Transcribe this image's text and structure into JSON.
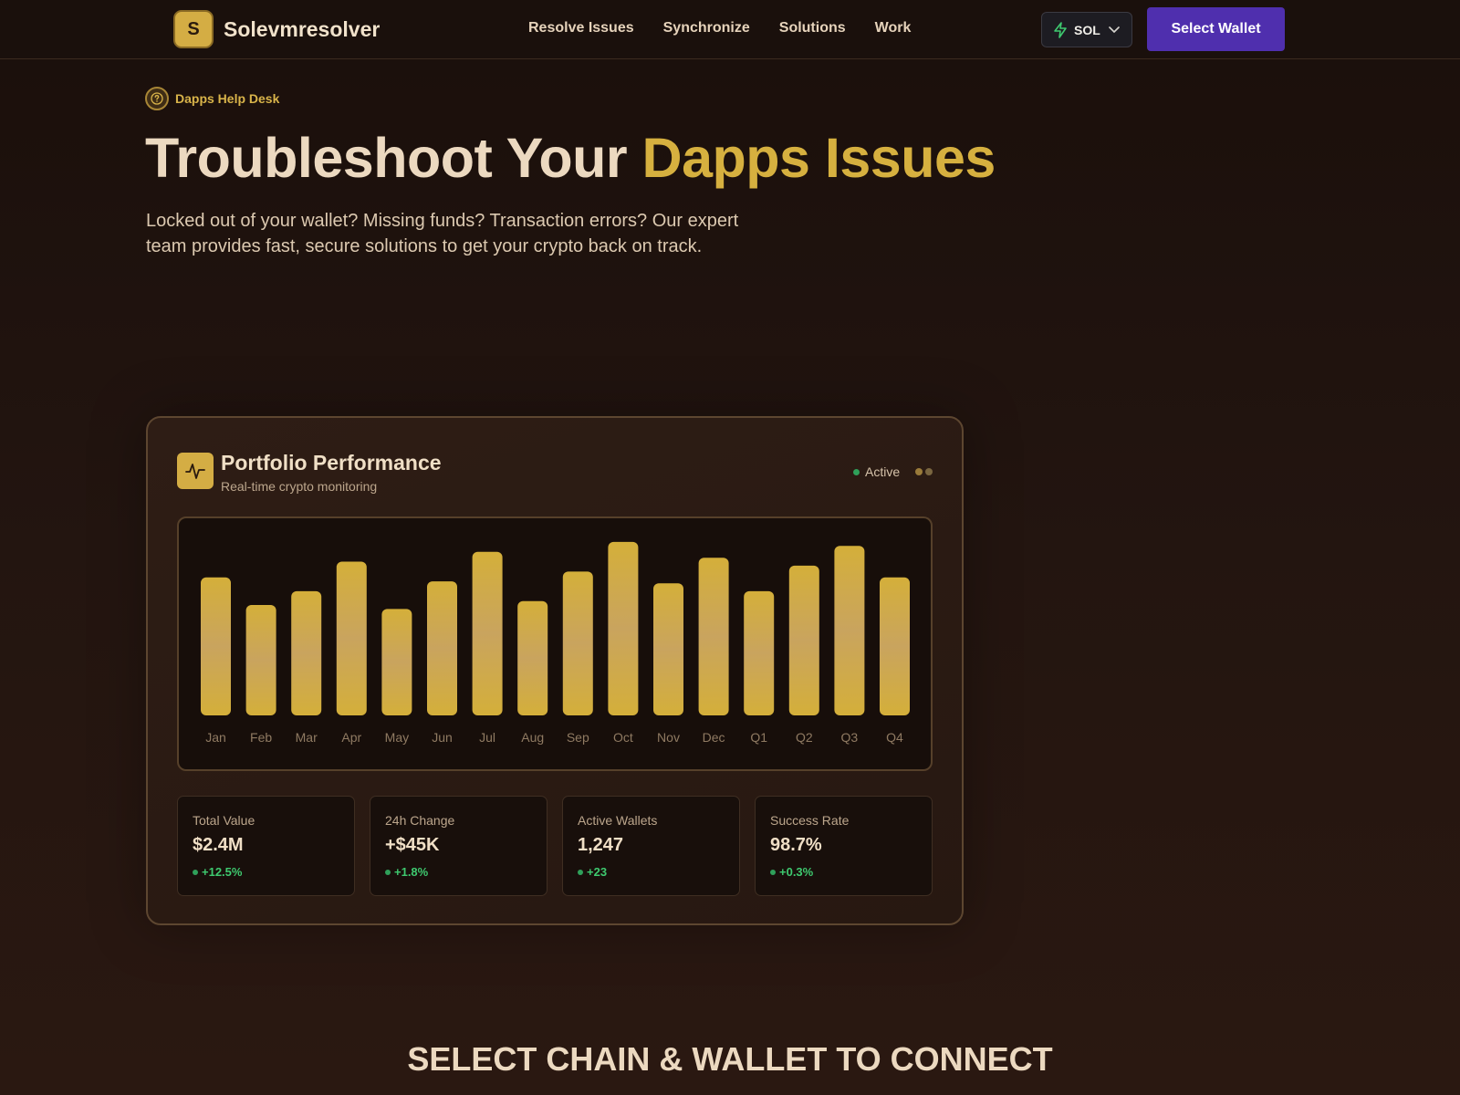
{
  "header": {
    "brand_initial": "S",
    "brand_name": "Solevmresolver",
    "nav": [
      "Resolve Issues",
      "Synchronize",
      "Solutions",
      "Work"
    ],
    "chain": "SOL",
    "chain_icon": "bolt-icon",
    "wallet_button": "Select Wallet"
  },
  "hero": {
    "badge": "Dapps Help Desk",
    "title_part1": "Troubleshoot Your ",
    "title_accent": "Dapps Issues",
    "subtitle": "Locked out of your wallet? Missing funds? Transaction errors? Our expert team provides fast, secure solutions to get your crypto back on track."
  },
  "card": {
    "title": "Portfolio Performance",
    "subtitle": "Real-time crypto monitoring",
    "status": "Active",
    "stats": [
      {
        "label": "Total Value",
        "value": "$2.4M",
        "change": "+12.5%"
      },
      {
        "label": "24h Change",
        "value": "+$45K",
        "change": "+1.8%"
      },
      {
        "label": "Active Wallets",
        "value": "1,247",
        "change": "+23"
      },
      {
        "label": "Success Rate",
        "value": "98.7%",
        "change": "+0.3%"
      }
    ]
  },
  "chart_data": {
    "type": "bar",
    "categories": [
      "Jan",
      "Feb",
      "Mar",
      "Apr",
      "May",
      "Jun",
      "Jul",
      "Aug",
      "Sep",
      "Oct",
      "Nov",
      "Dec",
      "Q1",
      "Q2",
      "Q3",
      "Q4"
    ],
    "values": [
      70,
      56,
      63,
      78,
      54,
      68,
      83,
      58,
      73,
      88,
      67,
      80,
      63,
      76,
      86,
      70
    ],
    "ylim": [
      0,
      100
    ],
    "grid": false,
    "bar_color": "#d4af3a"
  },
  "sections": {
    "connect_title": "SELECT CHAIN & WALLET TO CONNECT"
  }
}
